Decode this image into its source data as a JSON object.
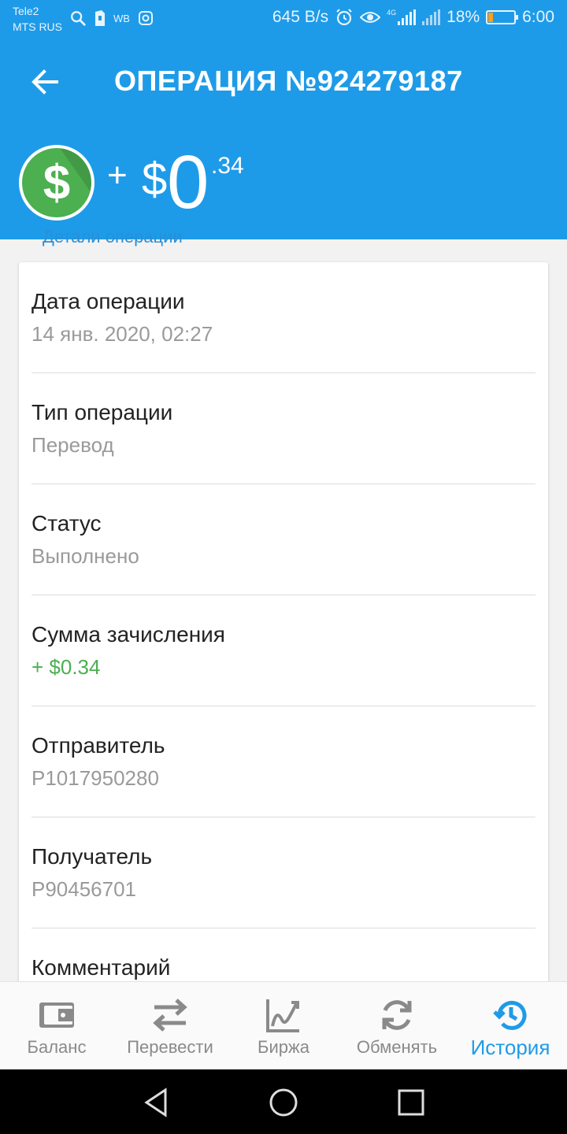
{
  "status_bar": {
    "carrier_line1": "Tele2",
    "carrier_line2": "MTS RUS",
    "left_icons": [
      "search-icon",
      "sim-icon",
      "wb-text",
      "instagram-icon"
    ],
    "wb_text": "WB",
    "net_speed": "645 B/s",
    "battery_percent": "18%",
    "battery_level": 0.18,
    "time": "6:00",
    "network_badge": "4G"
  },
  "app_bar": {
    "title": "ОПЕРАЦИЯ №924279187",
    "back_icon": "arrow-back-icon"
  },
  "amount": {
    "sign": "+",
    "currency": "$",
    "integer": "0",
    "fraction": ".34",
    "coin_symbol": "$",
    "coin_color": "#4caf50"
  },
  "section_label": "Детали операции",
  "details": [
    {
      "label": "Дата операции",
      "value": "14 янв. 2020, 02:27"
    },
    {
      "label": "Тип операции",
      "value": "Перевод"
    },
    {
      "label": "Статус",
      "value": "Выполнено"
    },
    {
      "label": "Сумма зачисления",
      "value": "+ $0.34"
    },
    {
      "label": "Отправитель",
      "value": "P1017950280"
    },
    {
      "label": "Получатель",
      "value": "P90456701"
    },
    {
      "label": "Комментарий",
      "value": ""
    }
  ],
  "bottom_nav": [
    {
      "label": "Баланс",
      "icon": "wallet-icon",
      "active": false
    },
    {
      "label": "Перевести",
      "icon": "transfer-arrows-icon",
      "active": false
    },
    {
      "label": "Биржа",
      "icon": "chart-trend-icon",
      "active": false
    },
    {
      "label": "Обменять",
      "icon": "exchange-refresh-icon",
      "active": false
    },
    {
      "label": "История",
      "icon": "history-clock-icon",
      "active": true
    }
  ],
  "colors": {
    "primary": "#1e9be8",
    "positive": "#4caf50",
    "muted_text": "#9a9a9a",
    "nav_inactive": "#8a8a8a"
  }
}
